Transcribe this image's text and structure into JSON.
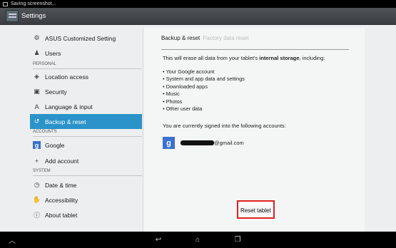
{
  "status_bar": {
    "text": "Saving screenshot..."
  },
  "action_bar": {
    "title": "Settings",
    "icon": "settings-app-icon"
  },
  "sidebar": {
    "items": [
      {
        "label": "ASUS Customized Setting",
        "icon": "gear-icon"
      },
      {
        "label": "Users",
        "icon": "user-icon"
      },
      {
        "label": "Location access",
        "icon": "location-icon"
      },
      {
        "label": "Security",
        "icon": "lock-icon"
      },
      {
        "label": "Language & input",
        "icon": "language-icon"
      },
      {
        "label": "Backup & reset",
        "icon": "backup-icon",
        "selected": true
      },
      {
        "label": "Google",
        "icon": "google-icon"
      },
      {
        "label": "Add account",
        "icon": "plus-icon"
      },
      {
        "label": "Date & time",
        "icon": "clock-icon"
      },
      {
        "label": "Accessibility",
        "icon": "hand-icon"
      },
      {
        "label": "About tablet",
        "icon": "info-icon"
      }
    ],
    "headers": [
      "PERSONAL",
      "ACCOUNTS",
      "SYSTEM"
    ]
  },
  "panel": {
    "breadcrumb_current": "Backup & reset",
    "breadcrumb_next": "Factory data reset",
    "warning_prefix": "This will erase all data from your tablet's ",
    "warning_bold": "internal storage",
    "warning_suffix": ", including:",
    "bullets": [
      "• Your Google account",
      "• System and app data and settings",
      "• Downloaded apps",
      "• Music",
      "• Photos",
      "• Other user data"
    ],
    "signed_in_text": "You are currently signed into the following accounts:",
    "account_email_suffix": "@gmail.com",
    "reset_button": "Reset tablet"
  },
  "colors": {
    "selected": "#2b93c9",
    "highlight_border": "#e02020"
  }
}
